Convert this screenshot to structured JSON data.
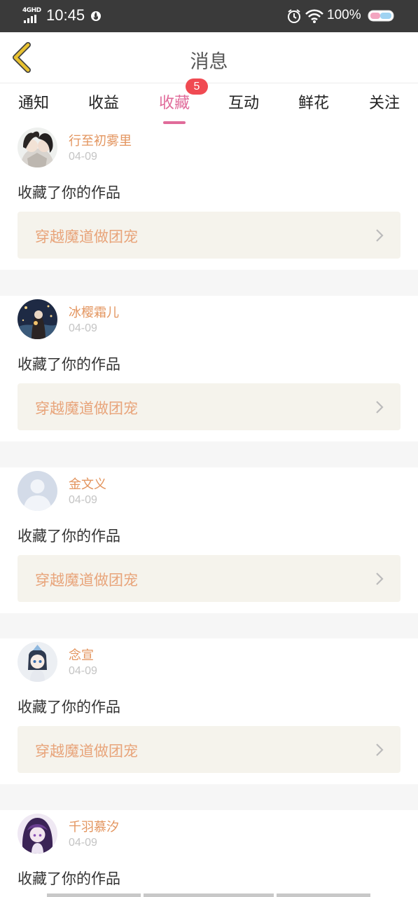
{
  "status_bar": {
    "network": "4GHD",
    "time": "10:45",
    "battery": "100%"
  },
  "header": {
    "title": "消息",
    "back_icon": "chevron-left-icon"
  },
  "tabs": [
    {
      "label": "通知",
      "active": false
    },
    {
      "label": "收益",
      "active": false
    },
    {
      "label": "收藏",
      "active": true,
      "badge": "5"
    },
    {
      "label": "互动",
      "active": false
    },
    {
      "label": "鲜花",
      "active": false
    },
    {
      "label": "关注",
      "active": false
    }
  ],
  "notifications": [
    {
      "username": "行至初雾里",
      "date": "04-09",
      "action": "收藏了你的作品",
      "work": "穿越魔道做团宠"
    },
    {
      "username": "冰樱霜儿",
      "date": "04-09",
      "action": "收藏了你的作品",
      "work": "穿越魔道做团宠"
    },
    {
      "username": "金文义",
      "date": "04-09",
      "action": "收藏了你的作品",
      "work": "穿越魔道做团宠"
    },
    {
      "username": "念宣",
      "date": "04-09",
      "action": "收藏了你的作品",
      "work": "穿越魔道做团宠"
    },
    {
      "username": "千羽慕汐",
      "date": "04-09",
      "action": "收藏了你的作品",
      "work": ""
    }
  ],
  "colors": {
    "accent": "#e06b9a",
    "username": "#e3955f",
    "work_title": "#e8a47a",
    "badge": "#f04a52",
    "back_icon": "#e9c230"
  }
}
